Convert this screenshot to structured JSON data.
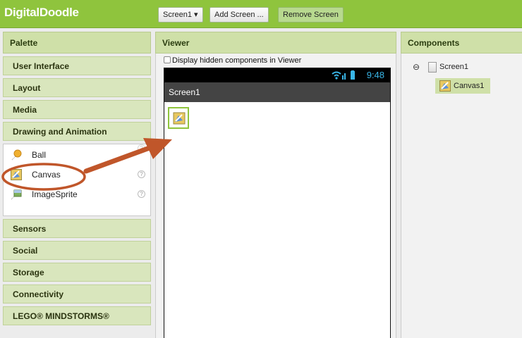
{
  "app": {
    "title": "DigitalDoodle"
  },
  "toolbar": {
    "screen_select": "Screen1 ▾",
    "add_screen": "Add Screen ...",
    "remove_screen": "Remove Screen"
  },
  "palette": {
    "header": "Palette",
    "categories_top": [
      "User Interface",
      "Layout",
      "Media",
      "Drawing and Animation"
    ],
    "items": [
      {
        "label": "Ball",
        "icon": "ball-icon"
      },
      {
        "label": "Canvas",
        "icon": "canvas-icon"
      },
      {
        "label": "ImageSprite",
        "icon": "imagesprite-icon"
      }
    ],
    "help_glyph": "?",
    "categories_bottom": [
      "Sensors",
      "Social",
      "Storage",
      "Connectivity",
      "LEGO® MINDSTORMS®"
    ]
  },
  "viewer": {
    "header": "Viewer",
    "hidden_label": "Display hidden components in Viewer",
    "status_time": "9:48",
    "screen_title": "Screen1"
  },
  "components": {
    "header": "Components",
    "collapse_glyph": "⊖",
    "screen": "Screen1",
    "canvas": "Canvas1"
  },
  "colors": {
    "accent": "#8fc43d",
    "annotation": "#c0562a",
    "status_icon": "#39b5e6"
  }
}
